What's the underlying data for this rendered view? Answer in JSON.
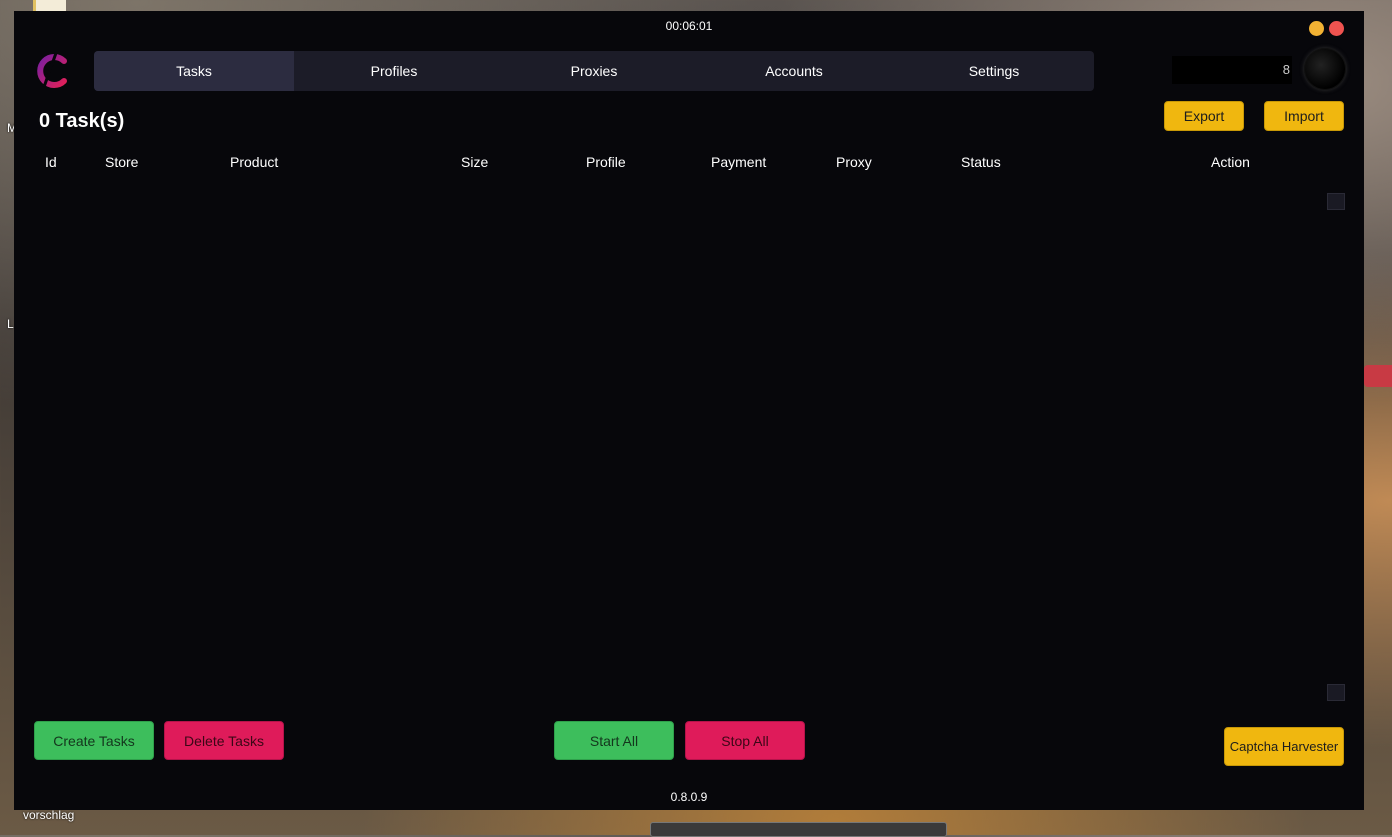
{
  "desktop": {
    "left_labels": [
      "M",
      "L"
    ],
    "bottom_label": "vorschlag"
  },
  "window": {
    "timer": "00:06:01"
  },
  "nav": {
    "tabs": [
      "Tasks",
      "Profiles",
      "Proxies",
      "Accounts",
      "Settings"
    ],
    "active": "Tasks"
  },
  "account": {
    "partial_text": "8"
  },
  "header": {
    "task_count": "0 Task(s)",
    "export_label": "Export",
    "import_label": "Import"
  },
  "table": {
    "columns": [
      "Id",
      "Store",
      "Product",
      "Size",
      "Profile",
      "Payment",
      "Proxy",
      "Status",
      "Action"
    ],
    "rows": []
  },
  "footer": {
    "create_label": "Create Tasks",
    "delete_label": "Delete Tasks",
    "start_label": "Start All",
    "stop_label": "Stop All",
    "captcha_label": "Captcha Harvester",
    "version": "0.8.0.9"
  },
  "colors": {
    "yellow": "#f0b70f",
    "green": "#3dbe5c",
    "red": "#df1b5a",
    "nav_bg": "#1c1c28",
    "nav_active": "#2c2c40",
    "window_bg": "#07070b"
  }
}
